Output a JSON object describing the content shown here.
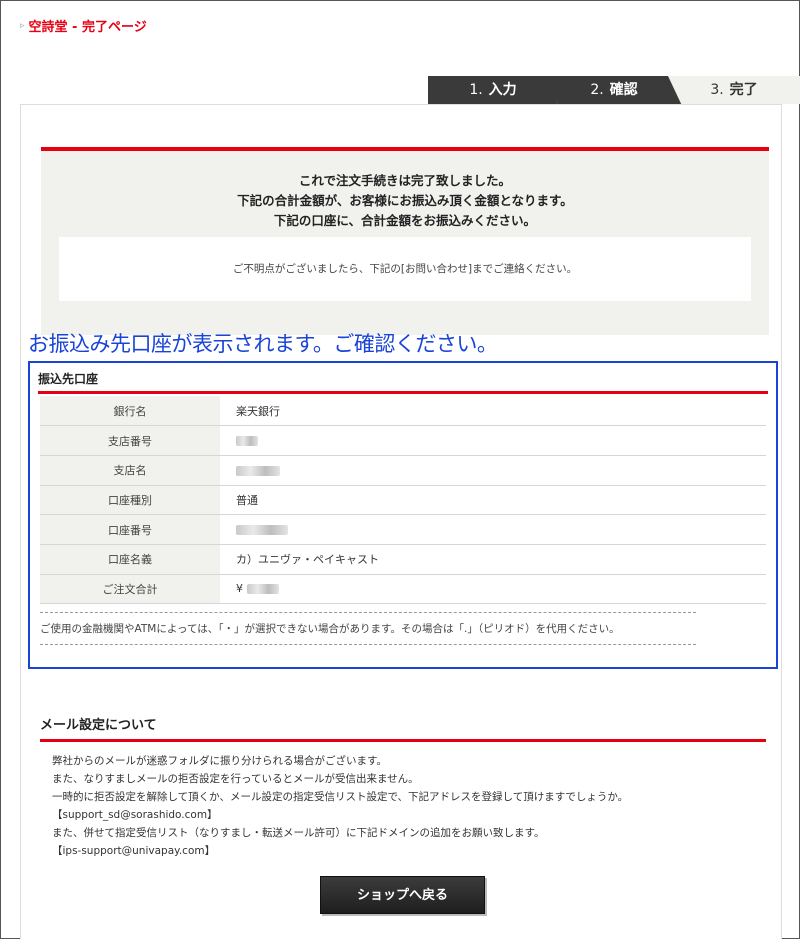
{
  "page_title": "空詩堂 - 完了ページ",
  "steps": [
    {
      "num": "1.",
      "label": "入力"
    },
    {
      "num": "2.",
      "label": "確認"
    },
    {
      "num": "3.",
      "label": "完了"
    }
  ],
  "notice": {
    "lines": [
      "これで注文手続きは完了致しました。",
      "下記の合計金額が、お客様にお振込み頂く金額となります。",
      "下記の口座に、合計金額をお振込みください。"
    ],
    "inquiry": "ご不明点がございましたら、下記の[お問い合わせ]までご連絡ください。"
  },
  "annotation": "お振込み先口座が表示されます。ご確認ください。",
  "bank": {
    "heading": "振込先口座",
    "rows": [
      {
        "label": "銀行名",
        "value": "楽天銀行"
      },
      {
        "label": "支店番号",
        "value": ""
      },
      {
        "label": "支店名",
        "value": ""
      },
      {
        "label": "口座種別",
        "value": "普通"
      },
      {
        "label": "口座番号",
        "value": ""
      },
      {
        "label": "口座名義",
        "value": "カ）ユニヴァ・ペイキャスト"
      },
      {
        "label": "ご注文合計",
        "value": "¥"
      }
    ],
    "caution": "ご使用の金融機関やATMによっては、「・」が選択できない場合があります。その場合は「.」（ピリオド）を代用ください。"
  },
  "mail": {
    "heading": "メール設定について",
    "lines": [
      "弊社からのメールが迷惑フォルダに振り分けられる場合がございます。",
      "また、なりすましメールの拒否設定を行っているとメールが受信出来ません。",
      "一時的に拒否設定を解除して頂くか、メール設定の指定受信リスト設定で、下記アドレスを登録して頂けますでしょうか。",
      "【support_sd@sorashido.com】",
      "また、併せて指定受信リスト（なりすまし・転送メール許可）に下記ドメインの追加をお願い致します。",
      "【ips-support@univapay.com】"
    ]
  },
  "back_button": "ショップへ戻る",
  "colors": {
    "accent": "#e60012",
    "annotation": "#1a44d8"
  }
}
